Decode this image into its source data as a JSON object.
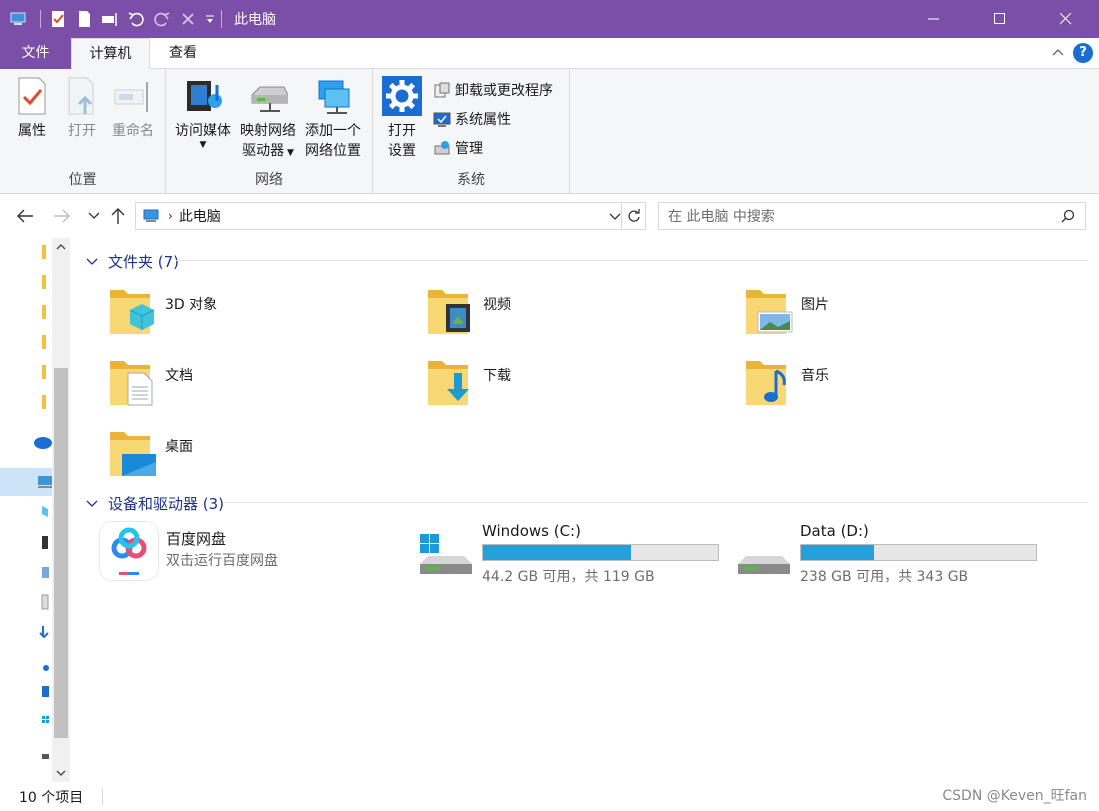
{
  "window": {
    "title": "此电脑",
    "accent": "#7b4fa8"
  },
  "ribbon_tabs": {
    "file": "文件",
    "computer": "计算机",
    "view": "查看"
  },
  "ribbon": {
    "location_group": {
      "label": "位置",
      "properties": "属性",
      "open": "打开",
      "rename": "重命名"
    },
    "network_group": {
      "label": "网络",
      "access_media": "访问媒体",
      "map_drive_1": "映射网络",
      "map_drive_2": "驱动器",
      "add_location_1": "添加一个",
      "add_location_2": "网络位置"
    },
    "system_group": {
      "label": "系统",
      "open_settings_1": "打开",
      "open_settings_2": "设置",
      "uninstall": "卸载或更改程序",
      "system_props": "系统属性",
      "manage": "管理"
    }
  },
  "address": {
    "location": "此电脑",
    "search_placeholder": "在 此电脑 中搜索"
  },
  "folders_section": {
    "title": "文件夹 (7)",
    "items": [
      {
        "name": "3D 对象",
        "icon": "3d-objects-folder-icon"
      },
      {
        "name": "视频",
        "icon": "videos-folder-icon"
      },
      {
        "name": "图片",
        "icon": "pictures-folder-icon"
      },
      {
        "name": "文档",
        "icon": "documents-folder-icon"
      },
      {
        "name": "下载",
        "icon": "downloads-folder-icon"
      },
      {
        "name": "音乐",
        "icon": "music-folder-icon"
      },
      {
        "name": "桌面",
        "icon": "desktop-folder-icon"
      }
    ]
  },
  "devices_section": {
    "title": "设备和驱动器 (3)",
    "app": {
      "name": "百度网盘",
      "desc": "双击运行百度网盘"
    },
    "drives": [
      {
        "name": "Windows (C:)",
        "info": "44.2 GB 可用，共 119 GB",
        "used_fraction": 0.63
      },
      {
        "name": "Data (D:)",
        "info": "238 GB 可用，共 343 GB",
        "used_fraction": 0.31
      }
    ]
  },
  "status": {
    "count": "10 个项目",
    "watermark": "CSDN @Keven_旺fan"
  }
}
